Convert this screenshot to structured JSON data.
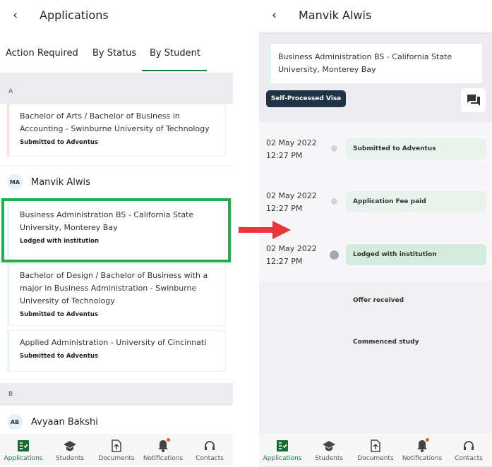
{
  "left": {
    "title": "Applications",
    "tabs": [
      {
        "label": "Action Required"
      },
      {
        "label": "By Status"
      },
      {
        "label": "By Student",
        "active": true
      }
    ],
    "sections": [
      {
        "letter": "A"
      },
      {
        "letter": "B"
      }
    ],
    "cards": [
      {
        "name": "Bachelor of Arts / Bachelor of Business in Accounting - Swinburne University of Technology",
        "status": "Submitted to Adventus"
      },
      {
        "name": "Business Administration BS - California State University, Monterey Bay",
        "status": "Lodged with institution",
        "highlighted": true
      },
      {
        "name": "Bachelor of Design / Bachelor of Business with a major in Business Administration - Swinburne University of Technology",
        "status": "Submitted to Adventus"
      },
      {
        "name": "Applied Administration - University of Cincinnati",
        "status": "Submitted to Adventus"
      }
    ],
    "students": [
      {
        "initials": "MA",
        "name": "Manvik Alwis"
      },
      {
        "initials": "AB",
        "name": "Avyaan Bakshi"
      }
    ]
  },
  "right": {
    "title": "Manvik Alwis",
    "program": "Business Administration BS - California State University, Monterey Bay",
    "visa_badge": "Self-Processed Visa",
    "timeline": [
      {
        "date": "02 May 2022",
        "time": "12:27 PM",
        "status": "Submitted to Adventus"
      },
      {
        "date": "02 May 2022",
        "time": "12:27 PM",
        "status": "Application Fee paid"
      },
      {
        "date": "02 May 2022",
        "time": "12:27 PM",
        "status": "Lodged with institution",
        "current": true
      }
    ],
    "pending": [
      "Offer received",
      "Commenced study"
    ]
  },
  "nav": [
    {
      "label": "Applications",
      "icon": "applications-icon",
      "active": true
    },
    {
      "label": "Students",
      "icon": "graduation-cap-icon"
    },
    {
      "label": "Documents",
      "icon": "document-upload-icon"
    },
    {
      "label": "Notifications",
      "icon": "bell-icon"
    },
    {
      "label": "Contacts",
      "icon": "headset-icon"
    }
  ],
  "colors": {
    "accent": "#1a7a3a",
    "highlight": "#1fae4b",
    "arrow": "#e8393a",
    "badge": "#1f3346"
  }
}
